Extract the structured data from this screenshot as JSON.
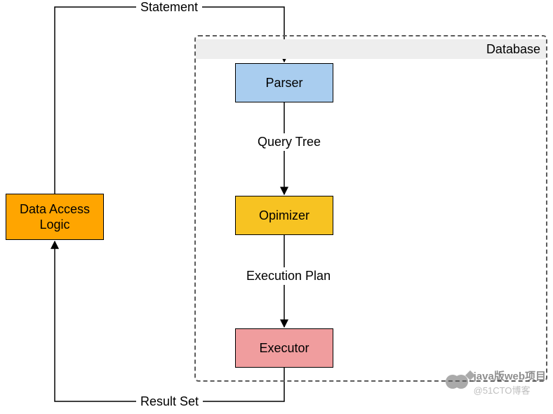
{
  "boxes": {
    "data_access": "Data Access\nLogic",
    "parser": "Parser",
    "optimizer": "Opimizer",
    "executor": "Executor"
  },
  "container": {
    "title": "Database"
  },
  "edges": {
    "statement": "Statement",
    "query_tree": "Query Tree",
    "execution_plan": "Execution Plan",
    "result_set": "Result Set"
  },
  "watermark": {
    "line1": "java版web项目",
    "line2": "@51CTO博客"
  },
  "colors": {
    "data_access": "#ffa500",
    "parser": "#a9cdef",
    "optimizer": "#f7c322",
    "executor": "#f09d9e"
  }
}
